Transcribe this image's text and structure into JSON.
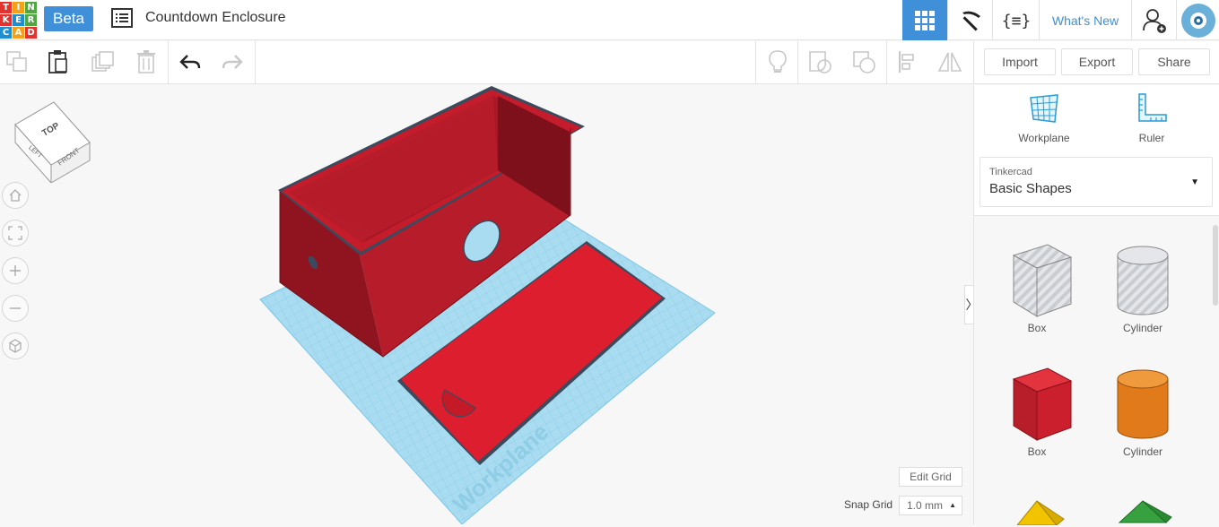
{
  "header": {
    "logo_letters": [
      "T",
      "I",
      "N",
      "K",
      "E",
      "R",
      "C",
      "A",
      "D"
    ],
    "beta_label": "Beta",
    "doc_title": "Countdown Enclosure",
    "whats_new": "What's New"
  },
  "toolbar": {
    "import_label": "Import",
    "export_label": "Export",
    "share_label": "Share"
  },
  "viewcube": {
    "top": "TOP",
    "left": "LEFT",
    "front": "FRONT"
  },
  "viewport": {
    "workplane_watermark": "Workplane",
    "edit_grid_label": "Edit Grid",
    "snap_grid_label": "Snap Grid",
    "snap_grid_value": "1.0 mm"
  },
  "panel": {
    "workplane_label": "Workplane",
    "ruler_label": "Ruler",
    "library_source": "Tinkercad",
    "library_name": "Basic Shapes",
    "shapes": [
      {
        "label": "Box"
      },
      {
        "label": "Cylinder"
      },
      {
        "label": "Box"
      },
      {
        "label": "Cylinder"
      }
    ]
  },
  "colors": {
    "accent": "#3f8fd9",
    "enclosure_red": "#b71c2a",
    "lid_red": "#dc1e2e",
    "workplane_blue": "#a9dcf0",
    "shape_orange": "#e07a1a"
  }
}
